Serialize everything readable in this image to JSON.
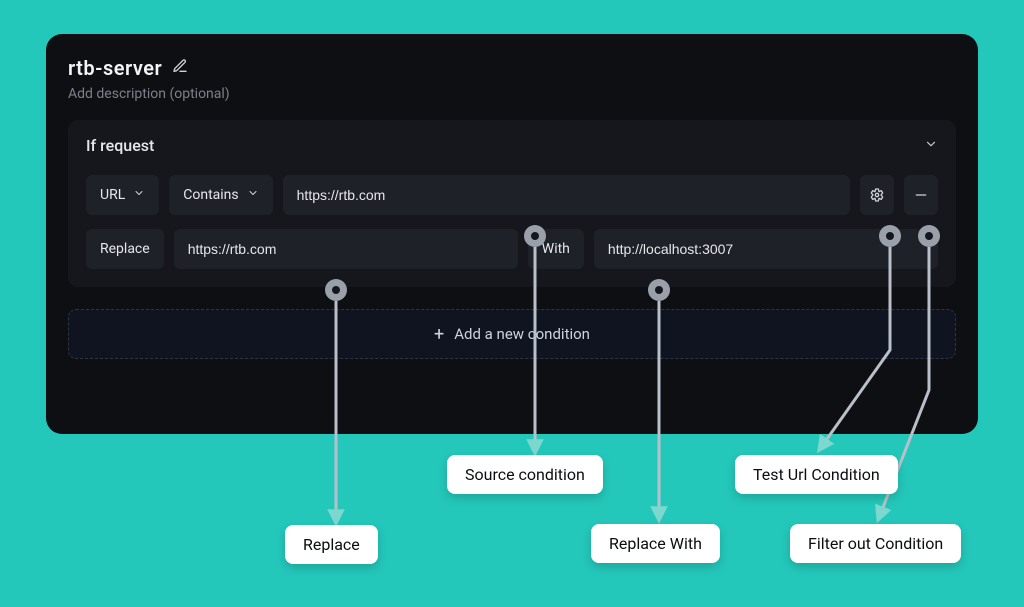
{
  "header": {
    "title": "rtb-server",
    "description_placeholder": "Add description (optional)"
  },
  "card": {
    "title": "If request",
    "url_dropdown": "URL",
    "contains_dropdown": "Contains",
    "match_value": "https://rtb.com",
    "replace_label": "Replace",
    "replace_value": "https://rtb.com",
    "with_label": "With",
    "with_value": "http://localhost:3007"
  },
  "add_button": "Add a new condition",
  "annotations": {
    "replace": "Replace",
    "source": "Source condition",
    "replace_with": "Replace With",
    "test_url": "Test Url Condition",
    "filter_out": "Filter out Condition"
  }
}
